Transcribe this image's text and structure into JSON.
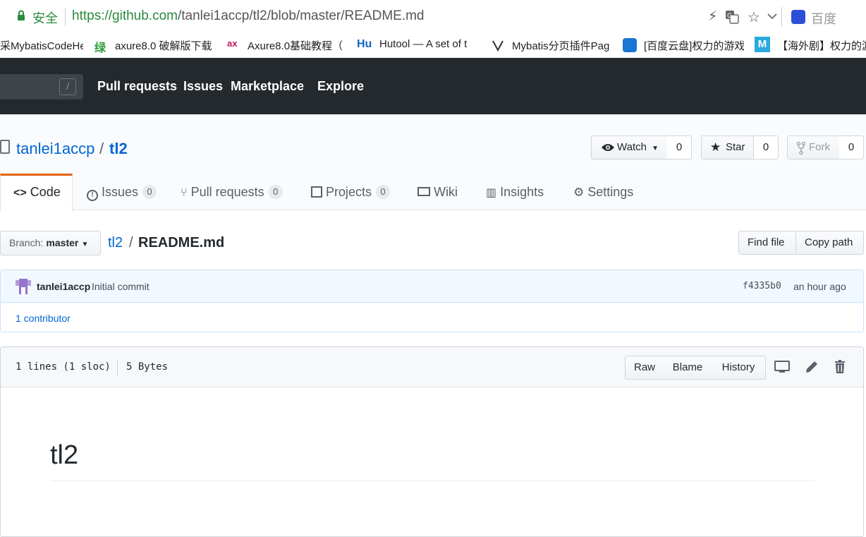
{
  "browser": {
    "secure_label": "安全",
    "url_host": "https://github.com",
    "url_path": "/tanlei1accp/tl2/blob/master/README.md",
    "search_engine": "百度"
  },
  "bookmarks": [
    {
      "icon": "",
      "label": "采MybatisCodeHe"
    },
    {
      "icon": "绿",
      "label": "axure8.0 破解版下载"
    },
    {
      "icon": "ax",
      "label": "Axure8.0基础教程（"
    },
    {
      "icon": "Hu",
      "label": "Hutool — A set of t"
    },
    {
      "icon": "",
      "label": "Mybatis分页插件Pag"
    },
    {
      "icon": "",
      "label": "[百度云盘]权力的游戏"
    },
    {
      "icon": "M",
      "label": "【海外剧】权力的游"
    }
  ],
  "header": {
    "search_shortcut": "/",
    "nav": [
      "Pull requests",
      "Issues",
      "Marketplace",
      "Explore"
    ]
  },
  "repo": {
    "owner": "tanlei1accp",
    "separator": "/",
    "name": "tl2",
    "watch_label": "Watch",
    "watch_count": "0",
    "star_label": "Star",
    "star_count": "0",
    "fork_label": "Fork",
    "fork_count": "0"
  },
  "tabs": [
    {
      "label": "Code"
    },
    {
      "label": "Issues",
      "count": "0"
    },
    {
      "label": "Pull requests",
      "count": "0"
    },
    {
      "label": "Projects",
      "count": "0"
    },
    {
      "label": "Wiki"
    },
    {
      "label": "Insights"
    },
    {
      "label": "Settings"
    }
  ],
  "filenav": {
    "branch_prefix": "Branch:",
    "branch": "master",
    "breadcrumb_repo": "tl2",
    "breadcrumb_sep": "/",
    "file": "README.md",
    "find_file": "Find file",
    "copy_path": "Copy path"
  },
  "commit": {
    "author": "tanlei1accp",
    "message": "Initial commit",
    "sha": "f4335b0",
    "time": "an hour ago",
    "contributors": "1 contributor"
  },
  "file": {
    "lines": "1 lines (1 sloc)",
    "size": "5 Bytes",
    "raw": "Raw",
    "blame": "Blame",
    "history": "History"
  },
  "readme": {
    "heading": "tl2"
  },
  "colors": {
    "header_bg": "#24292e",
    "link": "#0366d6",
    "active_tab_accent": "#e36209"
  }
}
